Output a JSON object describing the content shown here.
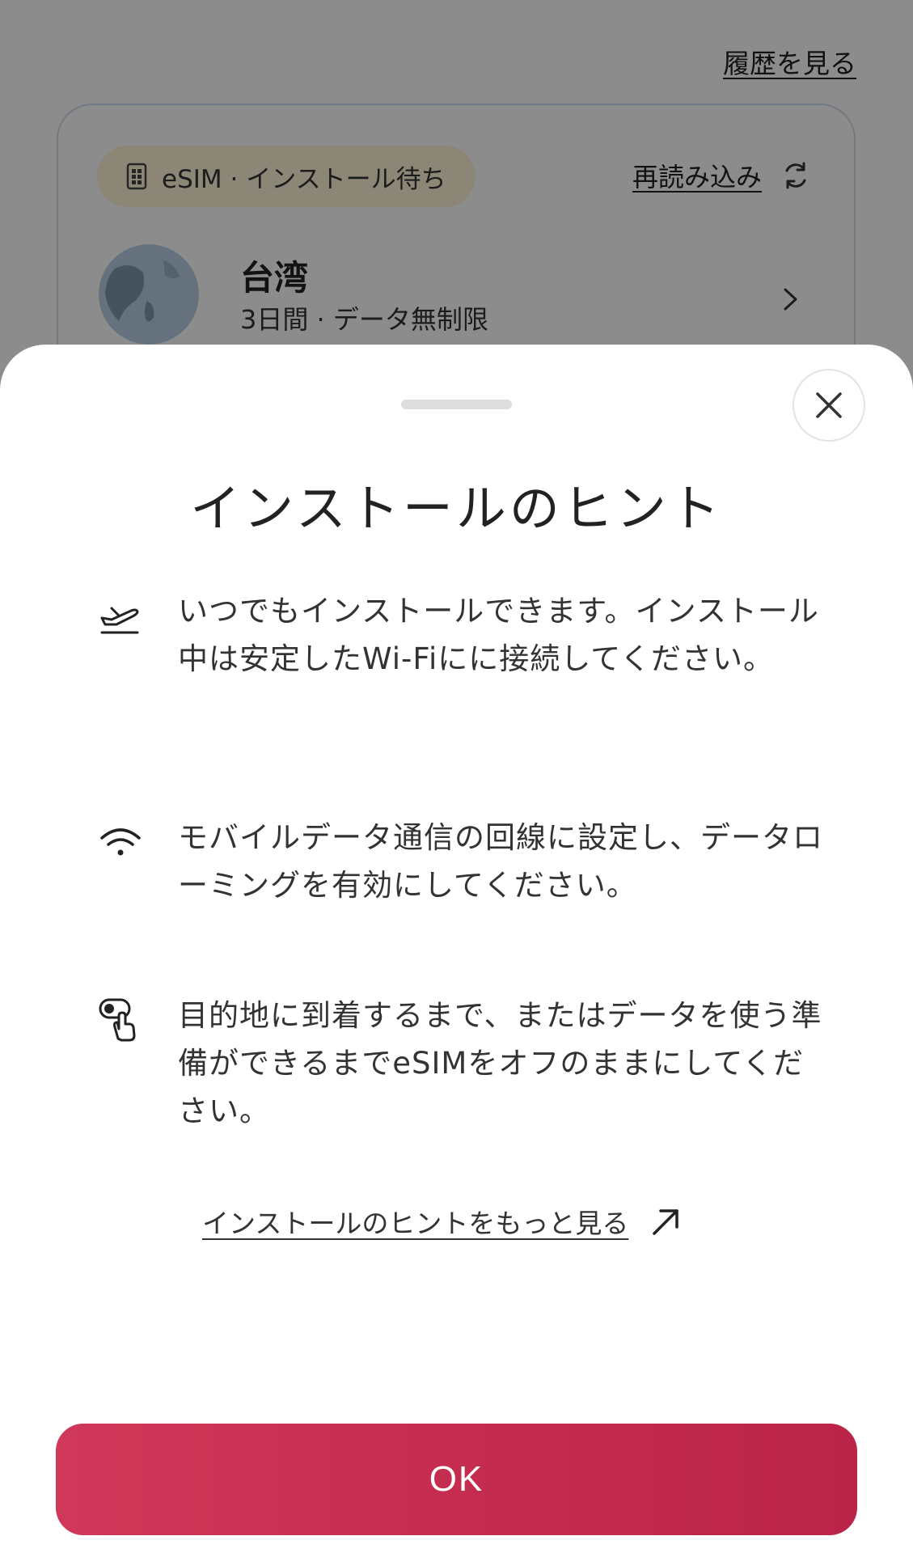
{
  "background": {
    "history_link": "履歴を見る",
    "esim_card": {
      "status": "eSIM · インストール待ち",
      "reload_label": "再読み込み",
      "country": "台湾",
      "plan": "3日間 · データ無制限"
    }
  },
  "sheet": {
    "title": "インストールのヒント",
    "tips": [
      {
        "icon": "airplane-takeoff-icon",
        "text": "いつでもインストールできます。インストール中は安定したWi-Fiにに接続してください。"
      },
      {
        "icon": "wifi-icon",
        "text": "モバイルデータ通信の回線に設定し、データローミングを有効にしてください。"
      },
      {
        "icon": "toggle-tap-icon",
        "text": "目的地に到着するまで、またはデータを使う準備ができるまでeSIMをオフのままにしてください。"
      }
    ],
    "more_link": "インストールのヒントをもっと見る",
    "ok_label": "OK"
  },
  "colors": {
    "ok_button": "#c52c50",
    "status_pill_bg": "#fff4d9",
    "card_border": "#cfdcef",
    "scrim": "rgba(0,0,0,0.45)"
  }
}
